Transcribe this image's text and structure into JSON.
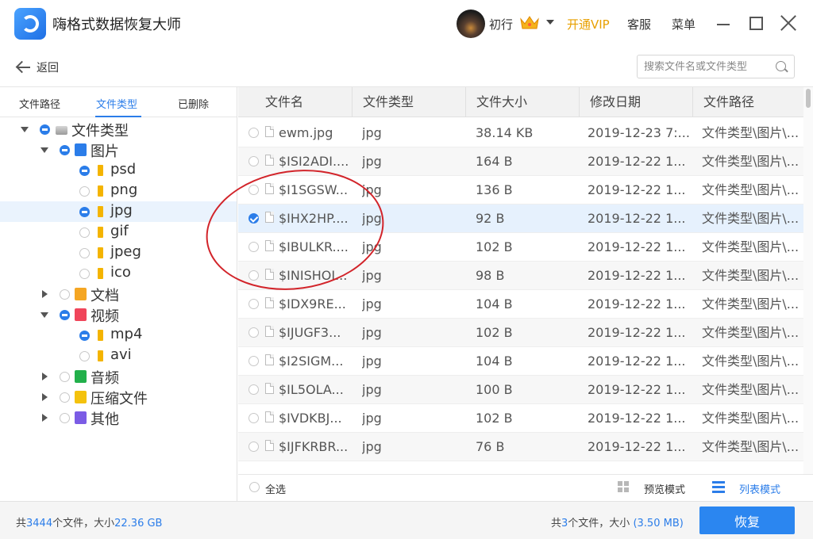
{
  "app": {
    "title": "嗨格式数据恢复大师"
  },
  "user": {
    "name": "初行",
    "vip": "开通VIP",
    "service": "客服",
    "menu": "菜单"
  },
  "nav": {
    "back": "返回",
    "search_placeholder": "搜索文件名或文件类型"
  },
  "left_tabs": [
    "文件路径",
    "文件类型",
    "已删除"
  ],
  "tree": [
    {
      "label": "文件类型",
      "depth": 0,
      "expand": "down",
      "state": "partial",
      "icon": "drive-icon"
    },
    {
      "label": "图片",
      "depth": 1,
      "expand": "down",
      "state": "partial",
      "icon": "image-icon",
      "color": "#2b7de9"
    },
    {
      "label": "psd",
      "depth": 2,
      "state": "partial",
      "icon": "folder-icon"
    },
    {
      "label": "png",
      "depth": 2,
      "state": "empty",
      "icon": "folder-icon"
    },
    {
      "label": "jpg",
      "depth": 2,
      "state": "partial",
      "icon": "folder-icon",
      "selected": true
    },
    {
      "label": "gif",
      "depth": 2,
      "state": "empty",
      "icon": "folder-icon"
    },
    {
      "label": "jpeg",
      "depth": 2,
      "state": "empty",
      "icon": "folder-icon"
    },
    {
      "label": "ico",
      "depth": 2,
      "state": "empty",
      "icon": "folder-icon"
    },
    {
      "label": "文档",
      "depth": 1,
      "expand": "right",
      "state": "empty",
      "icon": "document-icon",
      "color": "#f5a623"
    },
    {
      "label": "视频",
      "depth": 1,
      "expand": "down",
      "state": "partial",
      "icon": "video-icon",
      "color": "#f0455a"
    },
    {
      "label": "mp4",
      "depth": 2,
      "state": "partial",
      "icon": "folder-icon"
    },
    {
      "label": "avi",
      "depth": 2,
      "state": "empty",
      "icon": "folder-icon"
    },
    {
      "label": "音频",
      "depth": 1,
      "expand": "right",
      "state": "empty",
      "icon": "audio-icon",
      "color": "#22b04b"
    },
    {
      "label": "压缩文件",
      "depth": 1,
      "expand": "right",
      "state": "empty",
      "icon": "archive-icon",
      "color": "#f4c20d"
    },
    {
      "label": "其他",
      "depth": 1,
      "expand": "right",
      "state": "empty",
      "icon": "other-icon",
      "color": "#7b5ce5"
    }
  ],
  "table": {
    "columns": [
      "文件名",
      "文件类型",
      "文件大小",
      "修改日期",
      "文件路径"
    ],
    "rows": [
      {
        "name": "ewm.jpg",
        "type": "jpg",
        "size": "38.14 KB",
        "date": "2019-12-23 7:...",
        "path": "文件类型\\图片\\..."
      },
      {
        "name": "$ISI2ADI....",
        "type": "jpg",
        "size": "164 B",
        "date": "2019-12-22 1...",
        "path": "文件类型\\图片\\..."
      },
      {
        "name": "$I1SGSW...",
        "type": "jpg",
        "size": "136 B",
        "date": "2019-12-22 1...",
        "path": "文件类型\\图片\\..."
      },
      {
        "name": "$IHX2HP....",
        "type": "jpg",
        "size": "92 B",
        "date": "2019-12-22 1...",
        "path": "文件类型\\图片\\...",
        "checked": true
      },
      {
        "name": "$IBULKR....",
        "type": "jpg",
        "size": "102 B",
        "date": "2019-12-22 1...",
        "path": "文件类型\\图片\\..."
      },
      {
        "name": "$INISHOI...",
        "type": "jpg",
        "size": "98 B",
        "date": "2019-12-22 1...",
        "path": "文件类型\\图片\\..."
      },
      {
        "name": "$IDX9RE...",
        "type": "jpg",
        "size": "104 B",
        "date": "2019-12-22 1...",
        "path": "文件类型\\图片\\..."
      },
      {
        "name": "$IJUGF3...",
        "type": "jpg",
        "size": "102 B",
        "date": "2019-12-22 1...",
        "path": "文件类型\\图片\\..."
      },
      {
        "name": "$I2SIGM...",
        "type": "jpg",
        "size": "104 B",
        "date": "2019-12-22 1...",
        "path": "文件类型\\图片\\..."
      },
      {
        "name": "$IL5OLA...",
        "type": "jpg",
        "size": "100 B",
        "date": "2019-12-22 1...",
        "path": "文件类型\\图片\\..."
      },
      {
        "name": "$IVDKBJ...",
        "type": "jpg",
        "size": "102 B",
        "date": "2019-12-22 1...",
        "path": "文件类型\\图片\\..."
      },
      {
        "name": "$IJFKRBR...",
        "type": "jpg",
        "size": "76 B",
        "date": "2019-12-22 1...",
        "path": "文件类型\\图片\\..."
      }
    ]
  },
  "footer": {
    "select_all": "全选",
    "preview_mode": "预览模式",
    "list_mode": "列表模式"
  },
  "status": {
    "total_prefix": "共",
    "total_count": "3444",
    "total_mid": "个文件，大小",
    "total_size": "22.36 GB",
    "sel_prefix": "共",
    "sel_count": "3",
    "sel_mid": "个文件，大小",
    "sel_size": "(3.50 MB)",
    "recover": "恢复"
  },
  "colors": {
    "accent": "#2b7de9",
    "vip": "#e8a000",
    "annotation": "#d2242a"
  }
}
